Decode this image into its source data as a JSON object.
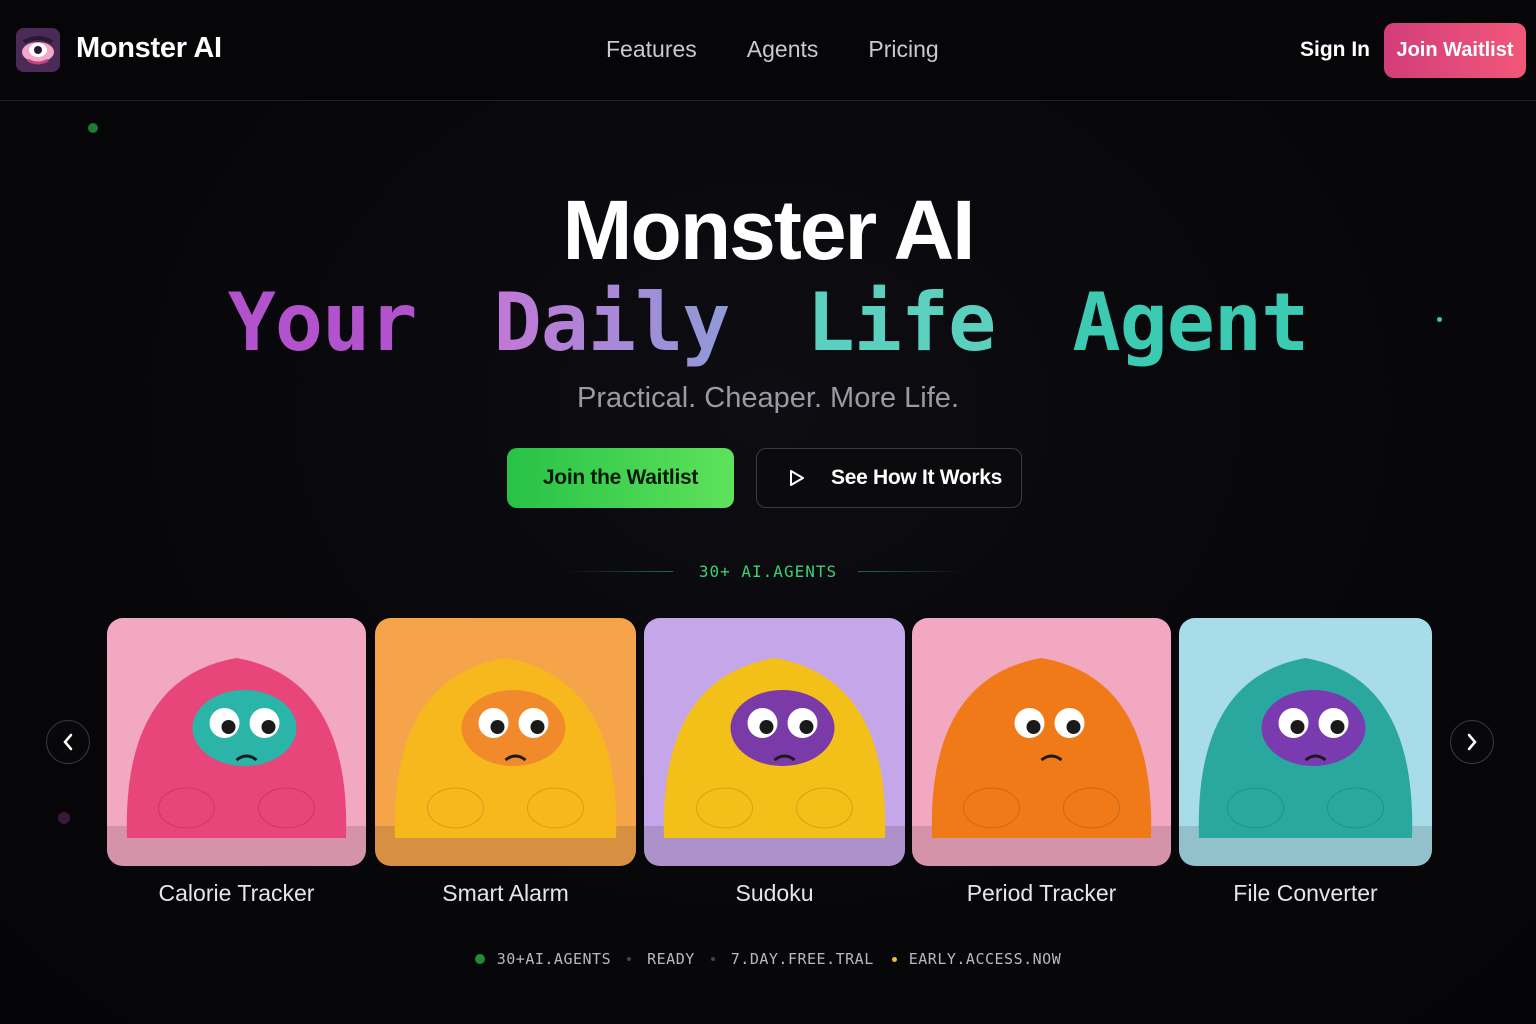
{
  "nav": {
    "brand": "Monster AI",
    "links": [
      "Features",
      "Agents",
      "Pricing"
    ],
    "signin": "Sign In",
    "join": "Join Waitlist"
  },
  "hero": {
    "title": "Monster AI",
    "subtitle_words": [
      "Your",
      "Daily",
      "Life",
      "Agent"
    ],
    "tagline": "Practical. Cheaper. More Life.",
    "cta_primary": "Join the Waitlist",
    "cta_secondary": "See How It Works"
  },
  "agents_label": "30+ AI.AGENTS",
  "agents": [
    {
      "name": "Calorie Tracker",
      "bg": "#f2a8c0",
      "body": "#e8457a",
      "face": "#2bb4a8",
      "icon": "apple-icon"
    },
    {
      "name": "Smart Alarm",
      "bg": "#f5a44a",
      "body": "#f7b81e",
      "face": "#f08a2a",
      "icon": "alarm-clock-icon"
    },
    {
      "name": "Sudoku",
      "bg": "#c5a6e8",
      "body": "#f2c018",
      "face": "#7a3aa8",
      "icon": "sudoku-board-icon"
    },
    {
      "name": "Period Tracker",
      "bg": "#f3a8c2",
      "body": "#f07a18",
      "face": "#f07a18",
      "icon": "calendar-icon"
    },
    {
      "name": "File Converter",
      "bg": "#a8dce8",
      "body": "#2aa8a0",
      "face": "#7a3ab0",
      "icon": "laptop-icon"
    }
  ],
  "status": [
    "30+AI.AGENTS",
    "READY",
    "7.DAY.FREE.TRAL",
    "EARLY.ACCESS.NOW"
  ],
  "colors": {
    "accent_pink": "#e3467a",
    "accent_green": "#3fd65a",
    "purple": "#b05ad0",
    "teal": "#3cc8b0"
  }
}
